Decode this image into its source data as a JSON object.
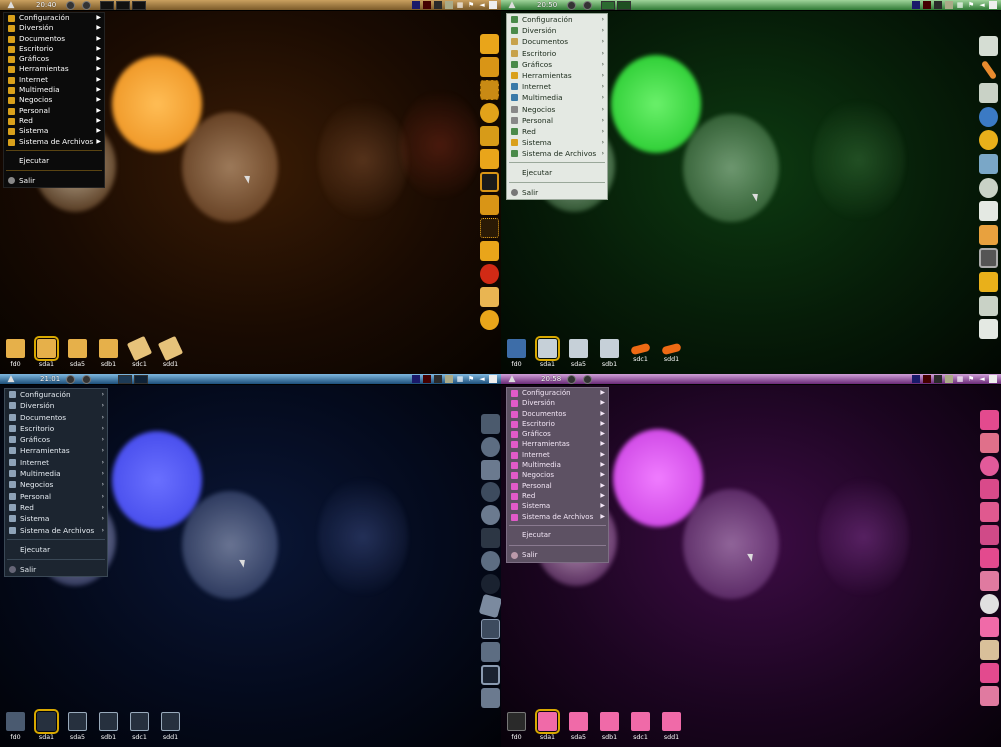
{
  "menu_items": [
    "Configuración",
    "Diversión",
    "Documentos",
    "Escritorio",
    "Gráficos",
    "Herramientas",
    "Internet",
    "Multimedia",
    "Negocios",
    "Personal",
    "Red",
    "Sistema",
    "Sistema de Archivos"
  ],
  "menu_run": "Ejecutar",
  "menu_exit": "Salir",
  "drives": [
    "fd0",
    "sda1",
    "sda5",
    "sdb1",
    "sdc1",
    "sdd1"
  ],
  "quadrants": [
    {
      "theme": "orange",
      "clock": "20:40",
      "accent": "#d49a10",
      "menu_bg": "#0d0d0d",
      "bg_a": "#3a1c05",
      "bg_b": "#080401",
      "bokeh_main": "#ffb246",
      "dock_color": "#e7a11a"
    },
    {
      "theme": "green",
      "clock": "20:50",
      "accent": "#39b54a",
      "menu_bg": "#e3e8e2",
      "bg_a": "#0d3a11",
      "bg_b": "#020b03",
      "bokeh_main": "#52e352",
      "dock_color": "#c9d2c6"
    },
    {
      "theme": "blue",
      "clock": "21:01",
      "accent": "#3da0e0",
      "menu_bg": "#1b2530",
      "bg_a": "#0a1636",
      "bg_b": "#010309",
      "bokeh_main": "#5a60ff",
      "dock_color": "#5d6d82"
    },
    {
      "theme": "purple",
      "clock": "20:58",
      "accent": "#c23bd8",
      "menu_bg": "#6a5d70",
      "bg_a": "#3d0c45",
      "bg_b": "#0a010c",
      "bokeh_main": "#e16cf2",
      "dock_color": "#e05a97"
    }
  ]
}
